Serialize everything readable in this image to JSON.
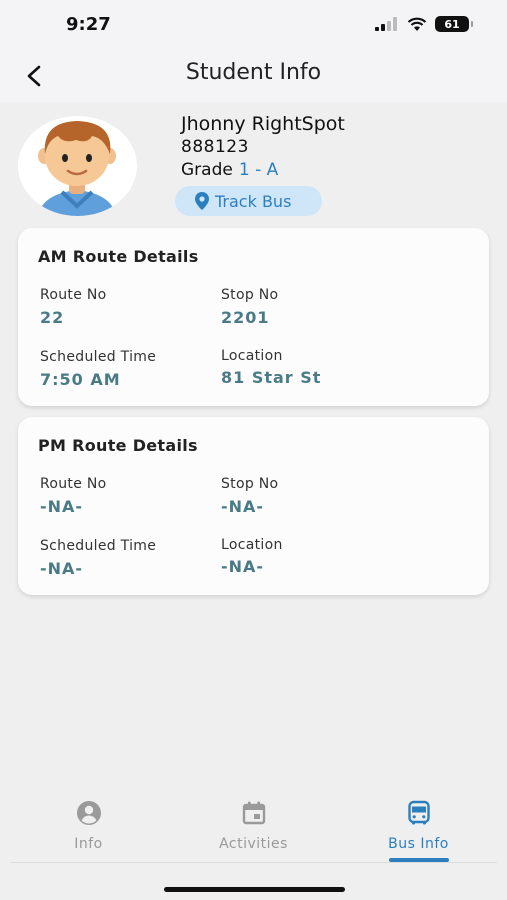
{
  "status_bar": {
    "time": "9:27",
    "battery": "61"
  },
  "nav": {
    "title": "Student Info"
  },
  "student": {
    "name": "Jhonny RightSpot",
    "id": "888123",
    "grade_label": "Grade",
    "grade_value": "1 - A",
    "track_bus_label": "Track Bus"
  },
  "am_route": {
    "title": "AM Route Details",
    "route_no_label": "Route No",
    "route_no": "22",
    "stop_no_label": "Stop No",
    "stop_no": "2201",
    "scheduled_time_label": "Scheduled Time",
    "scheduled_time": "7:50 AM",
    "location_label": "Location",
    "location": "81 Star St"
  },
  "pm_route": {
    "title": "PM Route Details",
    "route_no_label": "Route No",
    "route_no": "-NA-",
    "stop_no_label": "Stop No",
    "stop_no": "-NA-",
    "scheduled_time_label": "Scheduled Time",
    "scheduled_time": "-NA-",
    "location_label": "Location",
    "location": "-NA-"
  },
  "tabs": [
    {
      "label": "Info",
      "icon": "person-circle-icon",
      "active": false
    },
    {
      "label": "Activities",
      "icon": "calendar-icon",
      "active": false
    },
    {
      "label": "Bus Info",
      "icon": "bus-icon",
      "active": true
    }
  ],
  "colors": {
    "accent": "#2c7fbf",
    "value_text": "#4a7a86",
    "track_bus_bg": "#cfe6f8"
  }
}
